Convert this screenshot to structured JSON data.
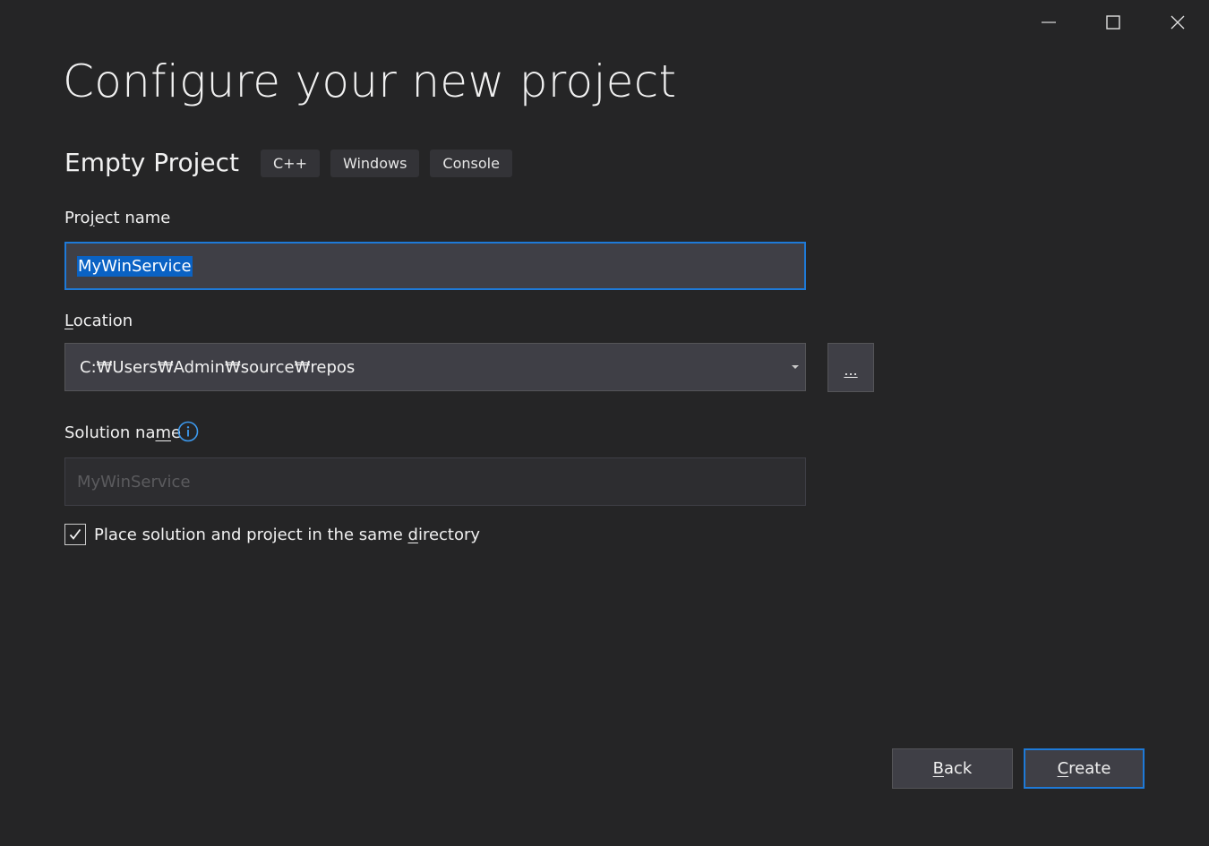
{
  "window": {
    "controls": {
      "minimize_icon": "minimize-icon",
      "maximize_icon": "maximize-icon",
      "close_icon": "close-icon"
    }
  },
  "header": {
    "title": "Configure your new project"
  },
  "template": {
    "name": "Empty Project",
    "tags": [
      "C++",
      "Windows",
      "Console"
    ]
  },
  "form": {
    "project_name": {
      "label_prefix": "Pro",
      "label_access": "j",
      "label_suffix": "ect name",
      "value": "MyWinService"
    },
    "location": {
      "label_access": "L",
      "label_suffix": "ocation",
      "value": "C:₩Users₩Admin₩source₩repos",
      "browse_label": "..."
    },
    "solution_name": {
      "label_prefix": "Solution na",
      "label_access": "m",
      "label_suffix": "e",
      "placeholder": "MyWinService",
      "info_icon": "info-icon"
    },
    "same_directory": {
      "checked": true,
      "label_prefix": "Place solution and project in the same ",
      "label_access": "d",
      "label_suffix": "irectory"
    }
  },
  "footer": {
    "back": {
      "access": "B",
      "rest": "ack"
    },
    "create": {
      "access": "C",
      "rest": "reate"
    }
  },
  "colors": {
    "background": "#252526",
    "accent": "#1e7ad8",
    "input_bg": "#3f3f46",
    "selection": "#0a62c4"
  }
}
